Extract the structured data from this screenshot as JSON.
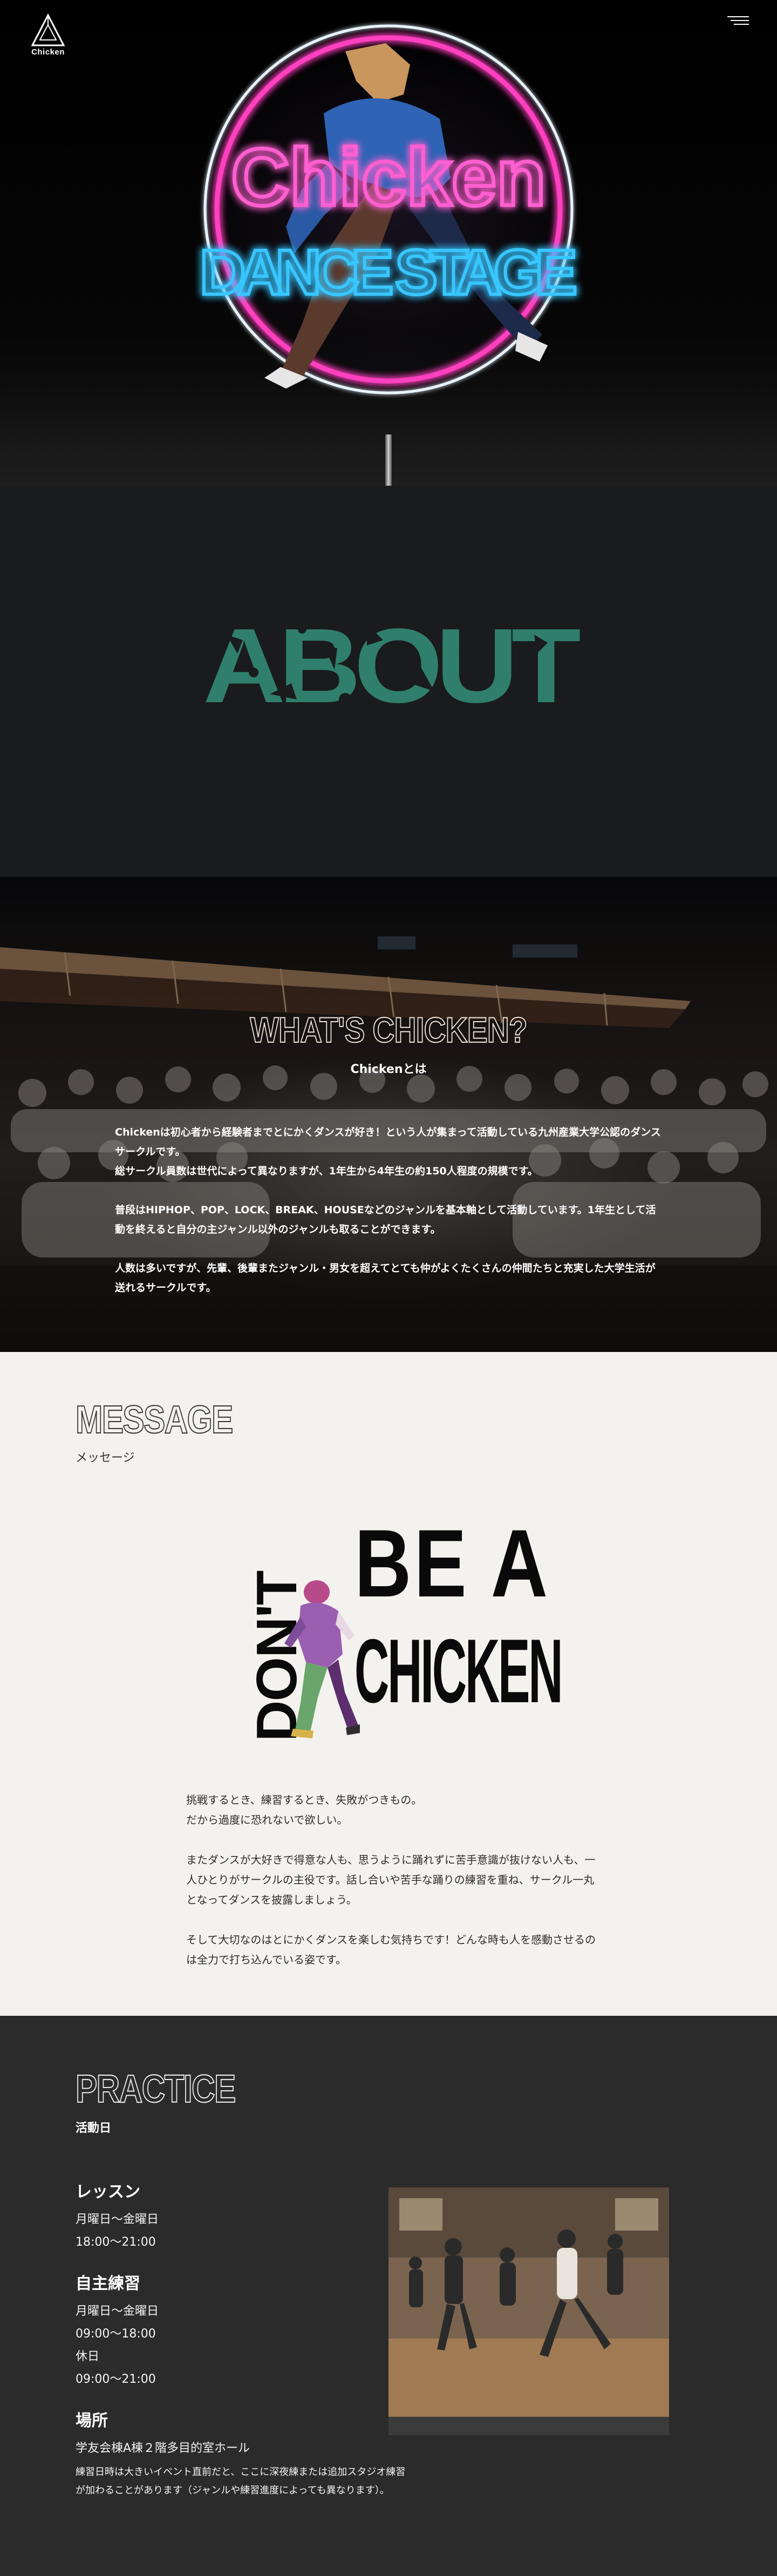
{
  "header": {
    "logo_text": "Chicken",
    "menu_icon": "hamburger-menu-icon"
  },
  "hero": {
    "neon_line1": "Chicken",
    "neon_line2": "DANCE STAGE",
    "colors": {
      "pink": "#ff3fbf",
      "blue": "#39c6ff"
    }
  },
  "about": {
    "title": "ABOUT",
    "title_color": "#2f7f6c"
  },
  "whats": {
    "title": "WHAT'S CHICKEN?",
    "subtitle": "Chickenとは",
    "paragraphs": [
      "Chickenは初心者から経験者までとにかくダンスが好き！という人が集まって活動している九州産業大学公認のダンスサークルです。\n総サークル員数は世代によって異なりますが、1年生から4年生の約150人程度の規模です。",
      "普段はHIPHOP、POP、LOCK、BREAK、HOUSEなどのジャンルを基本軸として活動しています。1年生として活動を終えると自分の主ジャンル以外のジャンルも取ることができます。",
      "人数は多いですが、先輩、後輩またジャンル・男女を超えてとても仲がよくたくさんの仲間たちと充実した大学生活が送れるサークルです。"
    ]
  },
  "message": {
    "title": "MESSAGE",
    "subtitle": "メッセージ",
    "poster": {
      "dont": "DON'T",
      "bea": "BE A",
      "chicken": "CHICKEN"
    },
    "paragraphs": [
      "挑戦するとき、練習するとき、失敗がつきもの。\nだから過度に恐れないで欲しい。",
      "またダンスが大好きで得意な人も、思うように踊れずに苦手意識が抜けない人も、一人ひとりがサークルの主役です。話し合いや苦手な踊りの練習を重ね、サークル一丸となってダンスを披露しましょう。",
      "そして大切なのはとにかくダンスを楽しむ気持ちです！どんな時も人を感動させるのは全力で打ち込んでいる姿です。"
    ]
  },
  "practice": {
    "title": "PRACTICE",
    "subtitle": "活動日",
    "lesson": {
      "heading": "レッスン",
      "days": "月曜日～金曜日",
      "time": "18:00～21:00"
    },
    "self": {
      "heading": "自主練習",
      "days": "月曜日～金曜日",
      "time": "09:00～18:00",
      "holiday": "休日",
      "holiday_time": "09:00～21:00"
    },
    "place": {
      "heading": "場所",
      "location": "学友会棟A棟２階多目的室ホール",
      "note": "練習日時は大きいイベント直前だと、ここに深夜練または追加スタジオ練習が加わることがあります（ジャンルや練習進度によっても異なります）。"
    }
  }
}
